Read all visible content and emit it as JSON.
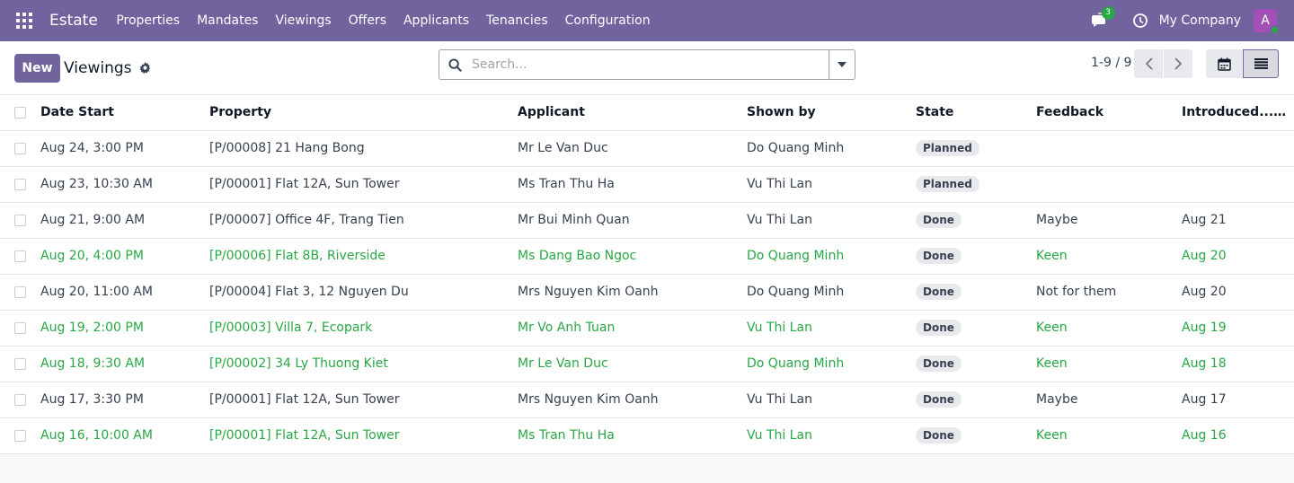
{
  "navbar": {
    "brand": "Estate",
    "menu": [
      "Properties",
      "Mandates",
      "Viewings",
      "Offers",
      "Applicants",
      "Tenancies",
      "Configuration"
    ],
    "chat_count": "3",
    "company": "My Company",
    "avatar_initial": "A",
    "bg_color": "#71639e"
  },
  "control": {
    "new_label": "New",
    "title": "Viewings",
    "search_placeholder": "Search...",
    "pager": "1-9 / 9"
  },
  "table": {
    "headers": [
      "Date Start",
      "Property",
      "Applicant",
      "Shown by",
      "State",
      "Feedback",
      "Introduced..."
    ],
    "rows": [
      {
        "date": "Aug 24, 3:00 PM",
        "property": "[P/00008] 21 Hang Bong",
        "applicant": "Mr Le Van Duc",
        "shown_by": "Do Quang Minh",
        "state": "Planned",
        "feedback": "",
        "introduced": "",
        "highlight": false
      },
      {
        "date": "Aug 23, 10:30 AM",
        "property": "[P/00001] Flat 12A, Sun Tower",
        "applicant": "Ms Tran Thu Ha",
        "shown_by": "Vu Thi Lan",
        "state": "Planned",
        "feedback": "",
        "introduced": "",
        "highlight": false
      },
      {
        "date": "Aug 21, 9:00 AM",
        "property": "[P/00007] Office 4F, Trang Tien",
        "applicant": "Mr Bui Minh Quan",
        "shown_by": "Vu Thi Lan",
        "state": "Done",
        "feedback": "Maybe",
        "introduced": "Aug 21",
        "highlight": false
      },
      {
        "date": "Aug 20, 4:00 PM",
        "property": "[P/00006] Flat 8B, Riverside",
        "applicant": "Ms Dang Bao Ngoc",
        "shown_by": "Do Quang Minh",
        "state": "Done",
        "feedback": "Keen",
        "introduced": "Aug 20",
        "highlight": true
      },
      {
        "date": "Aug 20, 11:00 AM",
        "property": "[P/00004] Flat 3, 12 Nguyen Du",
        "applicant": "Mrs Nguyen Kim Oanh",
        "shown_by": "Do Quang Minh",
        "state": "Done",
        "feedback": "Not for them",
        "introduced": "Aug 20",
        "highlight": false
      },
      {
        "date": "Aug 19, 2:00 PM",
        "property": "[P/00003] Villa 7, Ecopark",
        "applicant": "Mr Vo Anh Tuan",
        "shown_by": "Vu Thi Lan",
        "state": "Done",
        "feedback": "Keen",
        "introduced": "Aug 19",
        "highlight": true
      },
      {
        "date": "Aug 18, 9:30 AM",
        "property": "[P/00002] 34 Ly Thuong Kiet",
        "applicant": "Mr Le Van Duc",
        "shown_by": "Do Quang Minh",
        "state": "Done",
        "feedback": "Keen",
        "introduced": "Aug 18",
        "highlight": true
      },
      {
        "date": "Aug 17, 3:30 PM",
        "property": "[P/00001] Flat 12A, Sun Tower",
        "applicant": "Mrs Nguyen Kim Oanh",
        "shown_by": "Vu Thi Lan",
        "state": "Done",
        "feedback": "Maybe",
        "introduced": "Aug 17",
        "highlight": false
      },
      {
        "date": "Aug 16, 10:00 AM",
        "property": "[P/00001] Flat 12A, Sun Tower",
        "applicant": "Ms Tran Thu Ha",
        "shown_by": "Vu Thi Lan",
        "state": "Done",
        "feedback": "Keen",
        "introduced": "Aug 16",
        "highlight": true
      }
    ],
    "highlight_color": "#28a745"
  }
}
